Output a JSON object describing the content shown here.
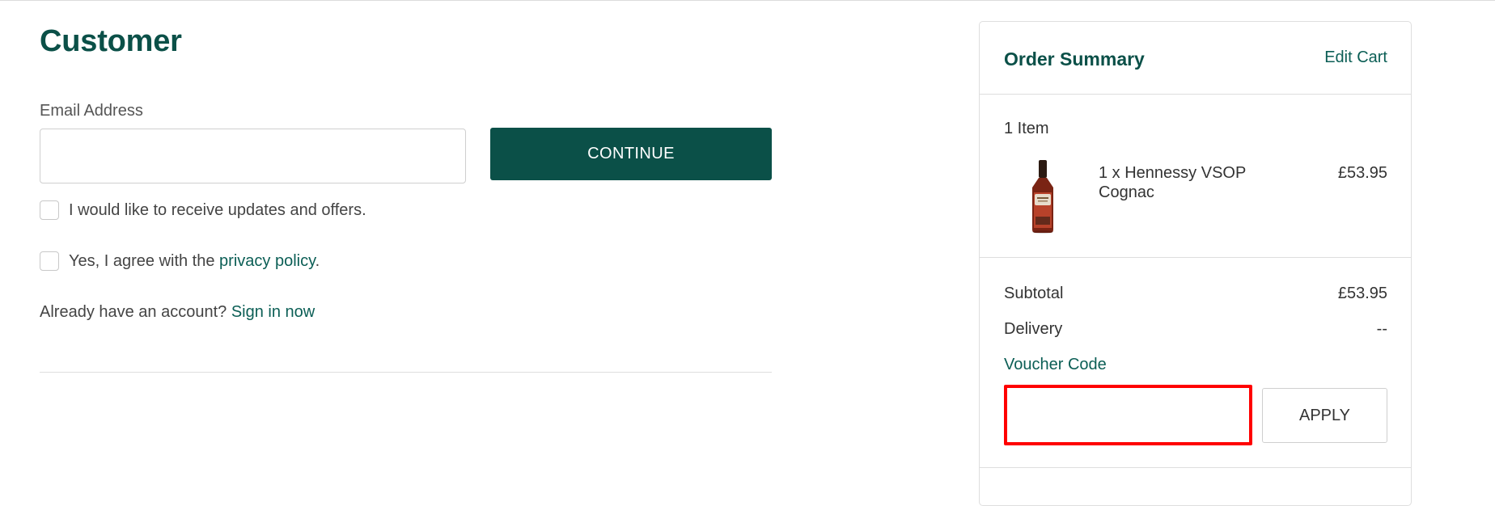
{
  "customer": {
    "title": "Customer",
    "email_label": "Email Address",
    "email_value": "",
    "email_placeholder": "",
    "continue_label": "CONTINUE",
    "updates_label": "I would like to receive updates and offers.",
    "privacy_prefix": "Yes, I agree with the ",
    "privacy_link": "privacy policy",
    "privacy_suffix": ".",
    "account_prefix": "Already have an account? ",
    "sign_in_link": "Sign in now"
  },
  "summary": {
    "title": "Order Summary",
    "edit_cart": "Edit Cart",
    "item_count": "1 Item",
    "item": {
      "name": "1 x Hennessy VSOP Cognac",
      "price": "£53.95",
      "image_icon": "cognac-bottle-image"
    },
    "subtotal_label": "Subtotal",
    "subtotal_value": "£53.95",
    "delivery_label": "Delivery",
    "delivery_value": "--",
    "voucher_label": "Voucher Code",
    "voucher_value": "",
    "apply_label": "APPLY"
  },
  "colors": {
    "brand_green": "#0b5048",
    "link_green": "#0b5e55",
    "highlight_red": "#ff0000"
  }
}
